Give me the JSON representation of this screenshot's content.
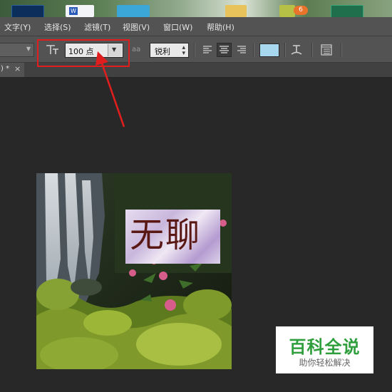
{
  "menu": {
    "items": [
      "文字(Y)",
      "选择(S)",
      "滤镜(T)",
      "视图(V)",
      "窗口(W)",
      "帮助(H)"
    ]
  },
  "desktop": {
    "badge_count": "6"
  },
  "options": {
    "font_size_value": "100 点",
    "antialias_label": "aa",
    "antialias_value": "锐利",
    "text_color": "#a8d8f0"
  },
  "tabs": {
    "close_glyph": "×",
    "active_suffix": ") *"
  },
  "canvas": {
    "text": "无聊"
  },
  "watermark": {
    "title": "百科全说",
    "subtitle": "助你轻松解决"
  },
  "colors": {
    "highlight_box": "#e01e1e",
    "arrow": "#e01e1e",
    "panel": "#535353",
    "workspace": "#282828"
  }
}
